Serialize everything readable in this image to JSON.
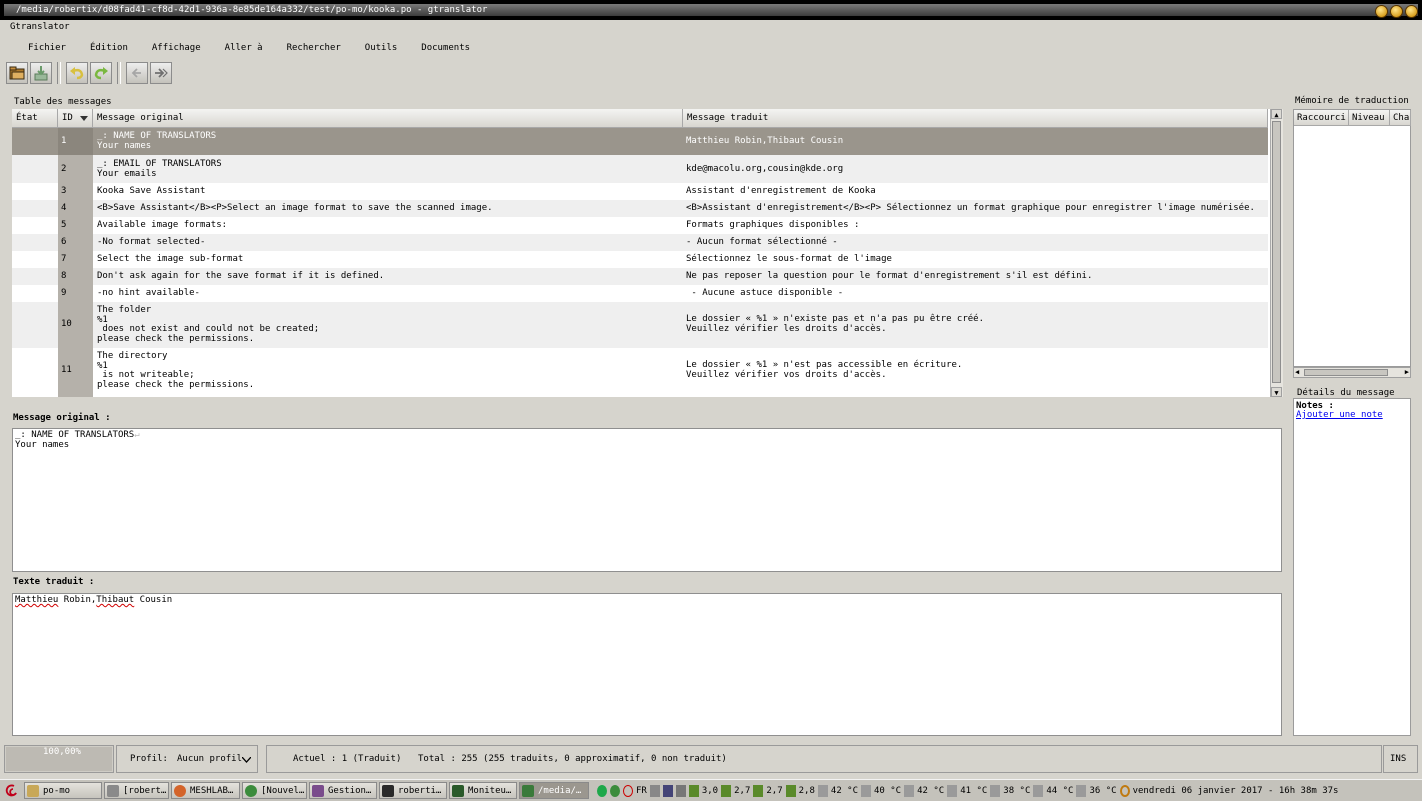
{
  "window": {
    "title": "/media/robertix/d08fad41-cf8d-42d1-936a-8e85de164a332/test/po-mo/kooka.po - gtranslator",
    "app_name": "Gtranslator"
  },
  "menu": [
    "Fichier",
    "Édition",
    "Affichage",
    "Aller à",
    "Rechercher",
    "Outils",
    "Documents"
  ],
  "toolbar": [
    "open-icon",
    "save-icon",
    "undo-icon",
    "redo-icon",
    "back-icon",
    "forward-icon"
  ],
  "message_table": {
    "label": "Table des messages",
    "headers": {
      "state": "État",
      "id": "ID",
      "original": "Message original",
      "translated": "Message traduit"
    },
    "rows": [
      {
        "id": "1",
        "original": "_: NAME OF TRANSLATORS\nYour names",
        "translated": "Matthieu Robin,Thibaut Cousin"
      },
      {
        "id": "2",
        "original": "_: EMAIL OF TRANSLATORS\nYour emails",
        "translated": "kde@macolu.org,cousin@kde.org"
      },
      {
        "id": "3",
        "original": "Kooka Save Assistant",
        "translated": "Assistant d'enregistrement de Kooka"
      },
      {
        "id": "4",
        "original": "<B>Save Assistant</B><P>Select an image format to save the scanned image.",
        "translated": "<B>Assistant d'enregistrement</B><P> Sélectionnez un format graphique pour enregistrer l'image numérisée."
      },
      {
        "id": "5",
        "original": "Available image formats:",
        "translated": "Formats graphiques disponibles :"
      },
      {
        "id": "6",
        "original": "-No format selected-",
        "translated": "- Aucun format sélectionné -"
      },
      {
        "id": "7",
        "original": "Select the image sub-format",
        "translated": "Sélectionnez le sous-format de l'image"
      },
      {
        "id": "8",
        "original": "Don't ask again for the save format if it is defined.",
        "translated": "Ne pas reposer la question pour le format d'enregistrement s'il est défini."
      },
      {
        "id": "9",
        "original": "-no hint available-",
        "translated": " - Aucune astuce disponible -"
      },
      {
        "id": "10",
        "original": "The folder\n%1\n does not exist and could not be created;\nplease check the permissions.",
        "translated": "Le dossier « %1 » n'existe pas et n'a pas pu être créé.\nVeuillez vérifier les droits d'accès."
      },
      {
        "id": "11",
        "original": "The directory\n%1\n is not writeable;\nplease check the permissions.",
        "translated": "Le dossier « %1 » n'est pas accessible en écriture.\nVeuillez vérifier vos droits d'accès."
      }
    ]
  },
  "original_message": {
    "label": "Message original :",
    "line1": "_: NAME OF TRANSLATORS",
    "line2": "Your names"
  },
  "translated_text": {
    "label": "Texte traduit :",
    "word1": "Matthieu",
    "word2": " Robin,",
    "word3": "Thibaut",
    "word4": " Cousin"
  },
  "translation_memory": {
    "label": "Mémoire de traduction",
    "columns": [
      "Raccourci",
      "Niveau",
      "Chaî"
    ]
  },
  "message_details": {
    "label": "Détails du message",
    "notes_label": "Notes :",
    "add_note_link": "Ajouter une note"
  },
  "statusbar": {
    "progress": "100,00%",
    "progress_fraction": 1.0,
    "profile_label": "Profil:",
    "profile_value": "Aucun profil",
    "current": "Actuel : 1 (Traduit)",
    "total": "Total : 255 (255 traduits, 0 approximatif, 0 non traduit)",
    "mode": "INS"
  },
  "taskbar": {
    "tasks": [
      {
        "label": "po-mo",
        "icon": "folder-icon",
        "color": "#c8a858"
      },
      {
        "label": "[robert…",
        "icon": "file-manager-icon",
        "color": "#8a8a8a"
      },
      {
        "label": "MESHLAB…",
        "icon": "firefox-icon",
        "color": "#d4642a"
      },
      {
        "label": "[Nouvel…",
        "icon": "chrome-icon",
        "color": "#3c8c3c"
      },
      {
        "label": "Gestion…",
        "icon": "gestion-icon",
        "color": "#7a4c8c"
      },
      {
        "label": "roberti…",
        "icon": "terminal-icon",
        "color": "#2a2a2a"
      },
      {
        "label": "Moniteu…",
        "icon": "monitor-icon",
        "color": "#2a5a2a"
      },
      {
        "label": "/media/…",
        "icon": "gtranslator-icon",
        "color": "#3a7a3a"
      }
    ],
    "lang": "FR",
    "readings": [
      "3,0",
      "2,7",
      "2,7",
      "2,8",
      "42 °C",
      "40 °C",
      "42 °C",
      "41 °C",
      "38 °C",
      "44 °C",
      "36 °C"
    ],
    "clock": "vendredi 06 janvier 2017 - 16h 38m 37s"
  }
}
